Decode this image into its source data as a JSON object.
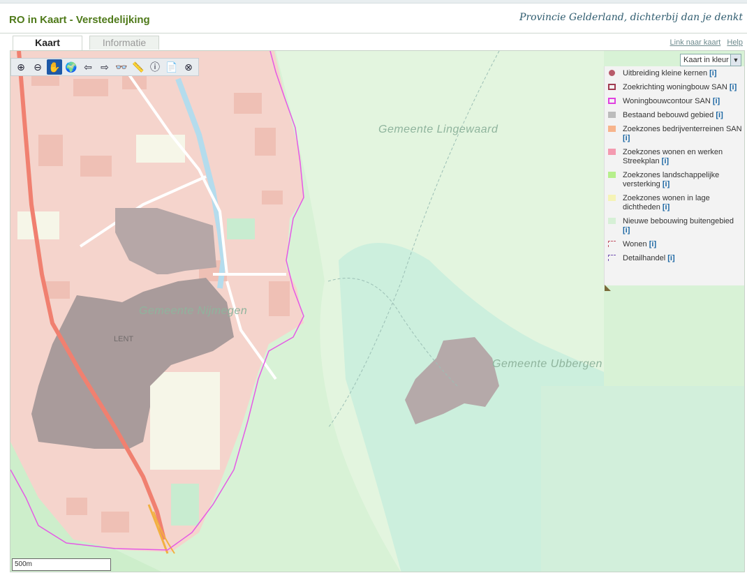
{
  "header": {
    "title": "RO in Kaart - Verstedelijking",
    "slogan": "Provincie Gelderland, dichterbij dan je denkt"
  },
  "tabs": [
    {
      "label": "Kaart",
      "active": true
    },
    {
      "label": "Informatie",
      "active": false
    }
  ],
  "links": {
    "link_map": "Link naar kaart",
    "help": "Help"
  },
  "toolbar": {
    "tools": [
      {
        "name": "zoom-in-icon",
        "glyph": "⊕"
      },
      {
        "name": "zoom-out-icon",
        "glyph": "⊖"
      },
      {
        "name": "pan-hand-icon",
        "glyph": "✋"
      },
      {
        "name": "zoom-extent-icon",
        "glyph": "🌍"
      },
      {
        "name": "back-arrow-icon",
        "glyph": "⇦"
      },
      {
        "name": "forward-arrow-icon",
        "glyph": "⇨"
      },
      {
        "name": "search-binoculars-icon",
        "glyph": "👓"
      },
      {
        "name": "measure-icon",
        "glyph": "📏"
      },
      {
        "name": "info-icon",
        "glyph": "ⓘ"
      },
      {
        "name": "pdf-icon",
        "glyph": "📄"
      },
      {
        "name": "close-map-icon",
        "glyph": "⊗"
      }
    ]
  },
  "layer_select": {
    "value": "Kaart in kleur"
  },
  "legend": {
    "items": [
      {
        "label": "Uitbreiding kleine kernen",
        "info": "[i]",
        "symbol": "dot",
        "color": "#b85a6a"
      },
      {
        "label": "Zoekrichting woningbouw SAN",
        "info": "[i]",
        "symbol": "outline",
        "color": "#a03a50"
      },
      {
        "label": "Woningbouwcontour SAN",
        "info": "[i]",
        "symbol": "outline",
        "color": "#e040e0"
      },
      {
        "label": "Bestaand bebouwd gebied",
        "info": "[i]",
        "symbol": "fill",
        "color": "#bcbcbc"
      },
      {
        "label": "Zoekzones bedrijventerreinen SAN",
        "info": "[i]",
        "symbol": "fill",
        "color": "#f7b48c"
      },
      {
        "label": "Zoekzones wonen en werken Streekplan",
        "info": "[i]",
        "symbol": "fill",
        "color": "#f49ab0"
      },
      {
        "label": "Zoekzones landschappelijke versterking",
        "info": "[i]",
        "symbol": "fill",
        "color": "#b6ef8c"
      },
      {
        "label": "Zoekzones wonen in lage dichtheden",
        "info": "[i]",
        "symbol": "fill",
        "color": "#f5f3b6"
      },
      {
        "label": "Nieuwe bebouwing buitengebied",
        "info": "[i]",
        "symbol": "fill",
        "color": "#d6f0d6"
      },
      {
        "label": "Wonen",
        "info": "[i]",
        "symbol": "dash",
        "color": "#c05060"
      },
      {
        "label": "Detailhandel",
        "info": "[i]",
        "symbol": "dash",
        "color": "#7050b0"
      }
    ]
  },
  "map_labels": {
    "lingewaard": "Gemeente  Lingewaard",
    "nijmegen": "Gemeente  Nijmegen",
    "ubbergen": "Gemeente  Ubbergen",
    "lent": "LENT"
  },
  "scalebar": {
    "label": "500m"
  }
}
